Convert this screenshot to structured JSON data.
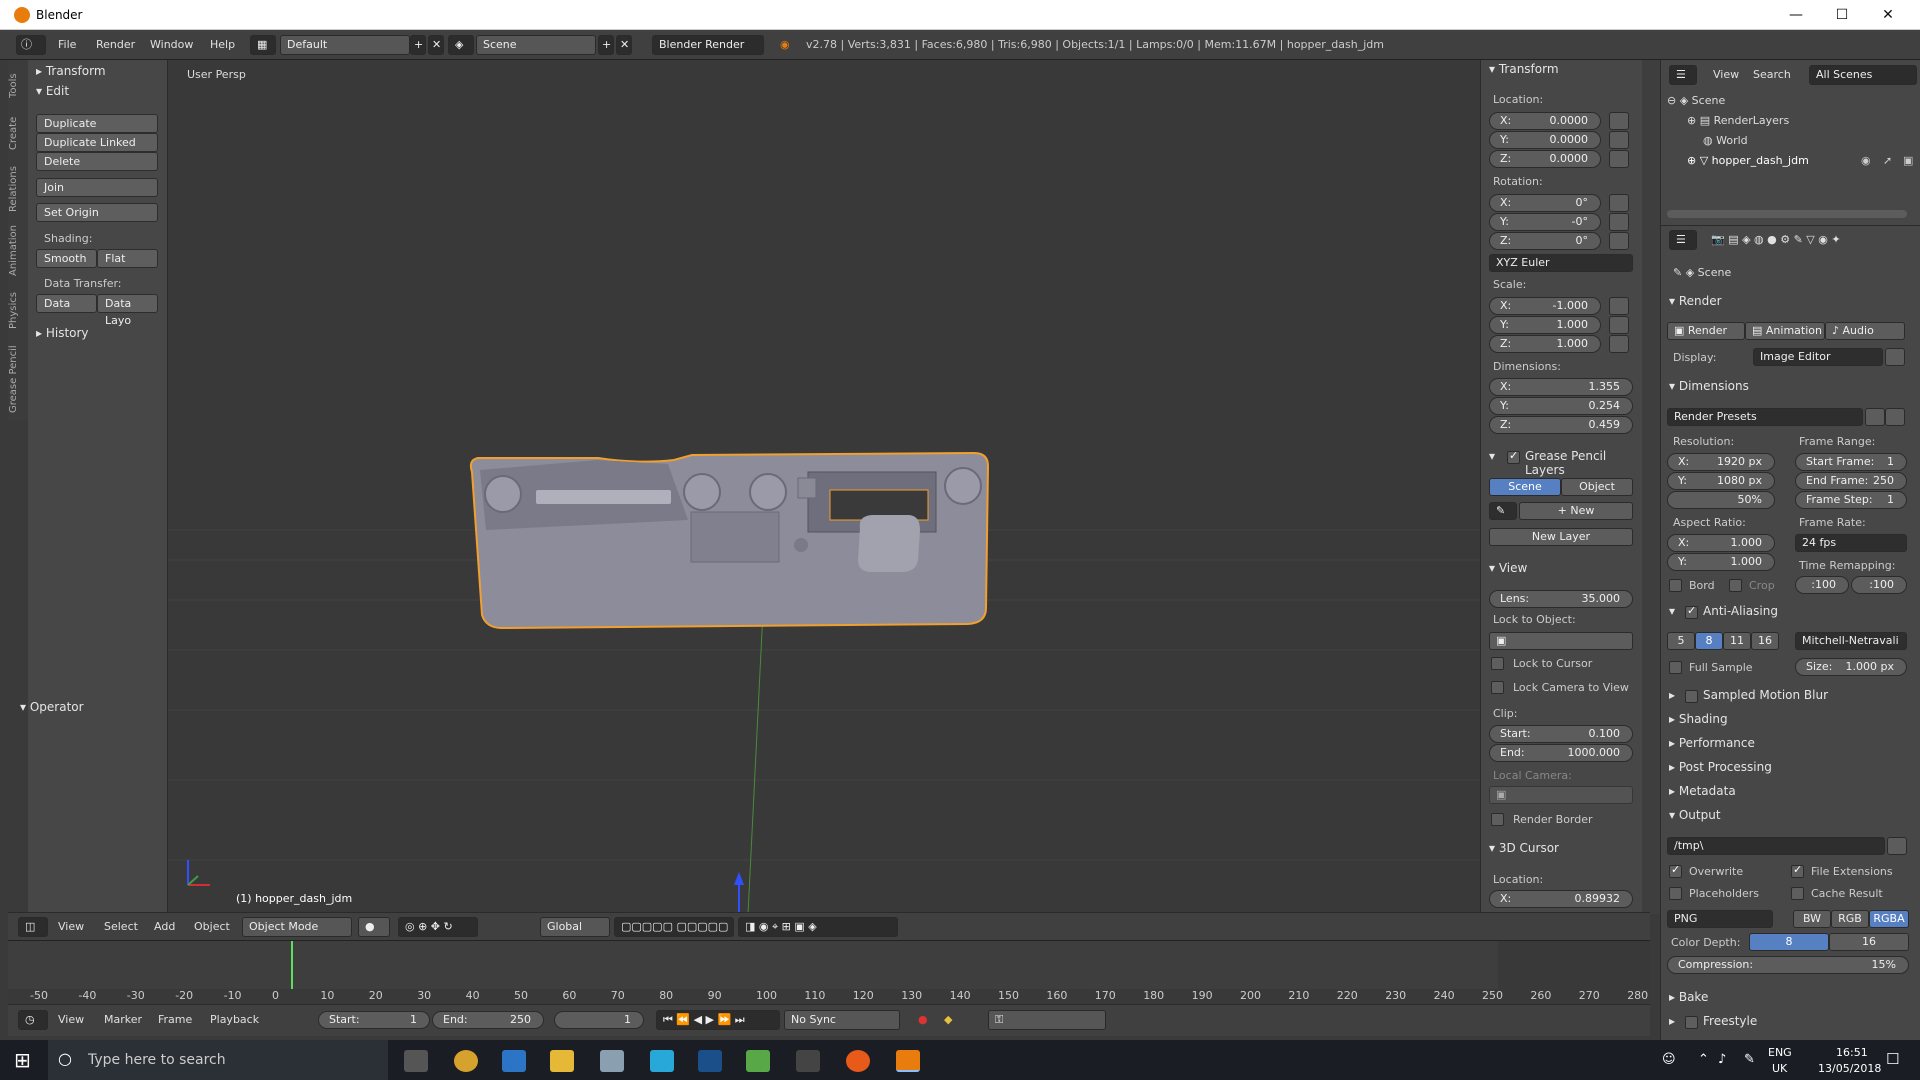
{
  "window": {
    "title": "Blender",
    "min": "—",
    "max": "☐",
    "close": "✕"
  },
  "info": {
    "menus": [
      "File",
      "Render",
      "Window",
      "Help"
    ],
    "layout": "Default",
    "scene": "Scene",
    "engine": "Blender Render",
    "stats": "v2.78 | Verts:3,831 | Faces:6,980 | Tris:6,980 | Objects:1/1 | Lamps:0/0 | Mem:11.67M | hopper_dash_jdm"
  },
  "tabs": [
    "Tools",
    "Create",
    "Relations",
    "Animation",
    "Physics",
    "Grease Pencil"
  ],
  "tools": {
    "transform": "Transform",
    "edit": "Edit",
    "duplicate": "Duplicate",
    "duplicate_linked": "Duplicate Linked",
    "delete": "Delete",
    "join": "Join",
    "set_origin": "Set Origin",
    "shading_label": "Shading:",
    "smooth": "Smooth",
    "flat": "Flat",
    "data_transfer_label": "Data Transfer:",
    "data": "Data",
    "data_layout": "Data Layo",
    "history": "History",
    "operator": "Operator"
  },
  "viewport": {
    "label": "User Persp",
    "object_label": "(1) hopper_dash_jdm"
  },
  "npanel": {
    "transform": "Transform",
    "location": "Location:",
    "loc": [
      [
        "X:",
        "0.0000"
      ],
      [
        "Y:",
        "0.0000"
      ],
      [
        "Z:",
        "0.0000"
      ]
    ],
    "rotation": "Rotation:",
    "rot": [
      [
        "X:",
        "0°"
      ],
      [
        "Y:",
        "-0°"
      ],
      [
        "Z:",
        "0°"
      ]
    ],
    "euler": "XYZ Euler",
    "scale": "Scale:",
    "scl": [
      [
        "X:",
        "-1.000"
      ],
      [
        "Y:",
        "1.000"
      ],
      [
        "Z:",
        "1.000"
      ]
    ],
    "dimensions": "Dimensions:",
    "dim": [
      [
        "X:",
        "1.355"
      ],
      [
        "Y:",
        "0.254"
      ],
      [
        "Z:",
        "0.459"
      ]
    ],
    "gp_layers": "Grease Pencil Layers",
    "gp_scene": "Scene",
    "gp_object": "Object",
    "gp_new": "New",
    "new_layer": "New Layer",
    "view": "View",
    "lens_k": "Lens:",
    "lens_v": "35.000",
    "lock_obj": "Lock to Object:",
    "lock_cursor": "Lock to Cursor",
    "lock_camera": "Lock Camera to View",
    "clip": "Clip:",
    "clip_start_k": "Start:",
    "clip_start_v": "0.100",
    "clip_end_k": "End:",
    "clip_end_v": "1000.000",
    "local_camera": "Local Camera:",
    "render_border": "Render Border",
    "cursor": "3D Cursor",
    "cursor_loc": "Location:",
    "cursor_x_k": "X:",
    "cursor_x_v": "0.89932"
  },
  "outliner": {
    "view": "View",
    "search": "Search",
    "all_scenes": "All Scenes",
    "scene": "Scene",
    "render_layers": "RenderLayers",
    "world": "World",
    "object": "hopper_dash_jdm"
  },
  "props": {
    "scene": "Scene",
    "render": "Render",
    "render_btn": "Render",
    "animation_btn": "Animation",
    "audio_btn": "Audio",
    "display_k": "Display:",
    "display_v": "Image Editor",
    "dimensions": "Dimensions",
    "presets": "Render Presets",
    "resolution": "Resolution:",
    "res_x_k": "X:",
    "res_x_v": "1920 px",
    "res_y_k": "Y:",
    "res_y_v": "1080 px",
    "res_pct": "50%",
    "frame_range": "Frame Range:",
    "start_frame_k": "Start Frame:",
    "start_frame_v": "1",
    "end_frame_k": "End Frame:",
    "end_frame_v": "250",
    "frame_step_k": "Frame Step:",
    "frame_step_v": "1",
    "aspect": "Aspect Ratio:",
    "asp_x_k": "X:",
    "asp_x_v": "1.000",
    "asp_y_k": "Y:",
    "asp_y_v": "1.000",
    "frame_rate": "Frame Rate:",
    "fps": "24 fps",
    "time_remap": "Time Remapping:",
    "remap_old": ":100",
    "remap_new": ":100",
    "bord": "Bord",
    "crop": "Crop",
    "aa": "Anti-Aliasing",
    "aa_levels": [
      "5",
      "8",
      "11",
      "16"
    ],
    "aa_filter": "Mitchell-Netravali",
    "full_sample": "Full Sample",
    "size_k": "Size:",
    "size_v": "1.000 px",
    "sections": [
      "Sampled Motion Blur",
      "Shading",
      "Performance",
      "Post Processing",
      "Metadata"
    ],
    "output": "Output",
    "output_path": "/tmp\\",
    "overwrite": "Overwrite",
    "file_ext": "File Extensions",
    "placeholders": "Placeholders",
    "cache_result": "Cache Result",
    "format": "PNG",
    "bw": "BW",
    "rgb": "RGB",
    "rgba": "RGBA",
    "color_depth": "Color Depth:",
    "depth8": "8",
    "depth16": "16",
    "compression_k": "Compression:",
    "compression_v": "15%",
    "bake": "Bake",
    "freestyle": "Freestyle"
  },
  "v3dheader": {
    "view": "View",
    "select": "Select",
    "add": "Add",
    "object": "Object",
    "mode": "Object Mode",
    "orientation": "Global"
  },
  "timeline": {
    "ticks": [
      "-50",
      "-40",
      "-30",
      "-20",
      "-10",
      "0",
      "10",
      "20",
      "30",
      "40",
      "50",
      "60",
      "70",
      "80",
      "90",
      "100",
      "110",
      "120",
      "130",
      "140",
      "150",
      "160",
      "170",
      "180",
      "190",
      "200",
      "210",
      "220",
      "230",
      "240",
      "250",
      "260",
      "270",
      "280"
    ],
    "view": "View",
    "marker": "Marker",
    "frame": "Frame",
    "playback": "Playback",
    "start_k": "Start:",
    "start_v": "1",
    "end_k": "End:",
    "end_v": "250",
    "current": "1",
    "sync": "No Sync"
  },
  "taskbar": {
    "search": "Type here to search",
    "lang": "ENG",
    "region": "UK",
    "time": "16:51",
    "date": "13/05/2018"
  },
  "colors": {
    "accent": "#5680c2",
    "selection": "#f0a030",
    "header": "#404040",
    "panel": "#474747",
    "viewport": "#393939"
  }
}
